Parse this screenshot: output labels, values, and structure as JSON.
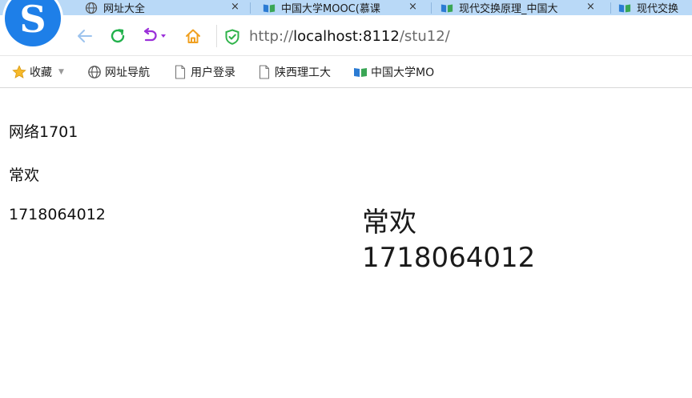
{
  "tabs": [
    {
      "label": "网址大全",
      "icon": "globe-icon",
      "close": "×"
    },
    {
      "label": "中国大学MOOC(慕课",
      "icon": "book-icon",
      "close": "×"
    },
    {
      "label": "现代交换原理_中国大",
      "icon": "book-icon",
      "close": "×"
    },
    {
      "label": "现代交换",
      "icon": "book-icon"
    }
  ],
  "logo": {
    "letter": "S",
    "color": "#1e7fe8"
  },
  "nav": {
    "url_scheme": "http://",
    "url_host": "localhost:8112",
    "url_path": "/stu12/"
  },
  "bookmarks": [
    {
      "label": "收藏",
      "icon": "star-icon"
    },
    {
      "label": "网址导航",
      "icon": "globe-icon"
    },
    {
      "label": "用户登录",
      "icon": "page-icon"
    },
    {
      "label": "陕西理工大",
      "icon": "page-icon"
    },
    {
      "label": "中国大学MO",
      "icon": "book-icon"
    }
  ],
  "page": {
    "class_name": "网络1701",
    "student_name": "常欢",
    "student_id": "1718064012",
    "big_name": "常欢",
    "big_id": "1718064012"
  },
  "colors": {
    "tab_bar": "#b9d9f7",
    "reload": "#22b14c",
    "undo": "#9b30d9",
    "home": "#f0a020",
    "shield": "#2fb34a",
    "back": "#9cc3ee"
  }
}
